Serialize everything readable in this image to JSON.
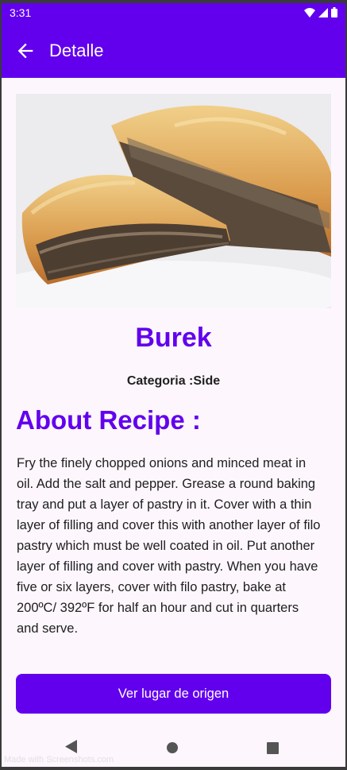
{
  "status_bar": {
    "time": "3:31"
  },
  "app_bar": {
    "title": "Detalle",
    "back_icon": "arrow-left-icon"
  },
  "recipe": {
    "name": "Burek",
    "category": "Categoria :Side",
    "about_heading": "About Recipe :",
    "description": "Fry the finely chopped onions and minced meat in oil. Add the salt and pepper. Grease a round baking tray and put a layer of pastry in it. Cover with a thin layer of filling and cover this with another layer of filo pastry which must be well coated in oil. Put another layer of filling and cover with pastry. When you have five or six layers, cover with filo pastry, bake at 200ºC/ 392ºF for half an hour and cut in quarters and serve."
  },
  "actions": {
    "origin_button": "Ver lugar de origen"
  },
  "watermark": "Made with Screenshots.com",
  "colors": {
    "primary": "#6200ee",
    "background": "#fdf7fd",
    "text": "#202020"
  }
}
